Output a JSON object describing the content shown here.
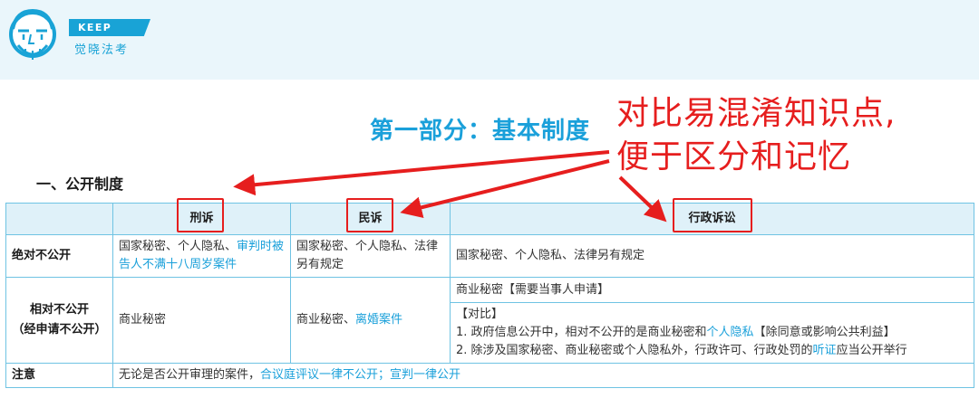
{
  "brand": {
    "name": "KEEP AWAKE",
    "subname": "觉晓法考"
  },
  "page_title": "第一部分：基本制度",
  "annotation": {
    "line1": "对比易混淆知识点,",
    "line2": "便于区分和记忆"
  },
  "section_heading": "一、公开制度",
  "table": {
    "headers": [
      "",
      "刑诉",
      "民诉",
      "行政诉讼"
    ],
    "rows": {
      "absolute": {
        "label": "绝对不公开",
        "criminal_plain": "国家秘密、个人隐私、",
        "criminal_highlight": "审判时被告人不满十八周岁案件",
        "civil": "国家秘密、个人隐私、法律另有规定",
        "admin": "国家秘密、个人隐私、法律另有规定"
      },
      "relative": {
        "label_line1": "相对不公开",
        "label_line2": "（经申请不公开）",
        "criminal": "商业秘密",
        "civil_plain": "商业秘密、",
        "civil_highlight": "离婚案件",
        "admin_top": "商业秘密【需要当事人申请】",
        "admin_compare_title": "【对比】",
        "admin_item1_a": "1. 政府信息公开中，相对不公开的是商业秘密和",
        "admin_item1_hl": "个人隐私",
        "admin_item1_b": "【除同意或影响公共利益】",
        "admin_item2_a": "2. 除涉及国家秘密、商业秘密或个人隐私外，行政许可、行政处罚的",
        "admin_item2_hl": "听证",
        "admin_item2_b": "应当公开举行"
      },
      "note": {
        "label": "注意",
        "plain": "无论是否公开审理的案件，",
        "highlight": "合议庭评议一律不公开；宣判一律公开"
      }
    }
  },
  "colors": {
    "accent_blue": "#1aa0da",
    "annotation_red": "#e61e1e",
    "header_band": "#eaf6fb",
    "table_border": "#6fc3e3",
    "table_header_bg": "#dff1f9"
  }
}
